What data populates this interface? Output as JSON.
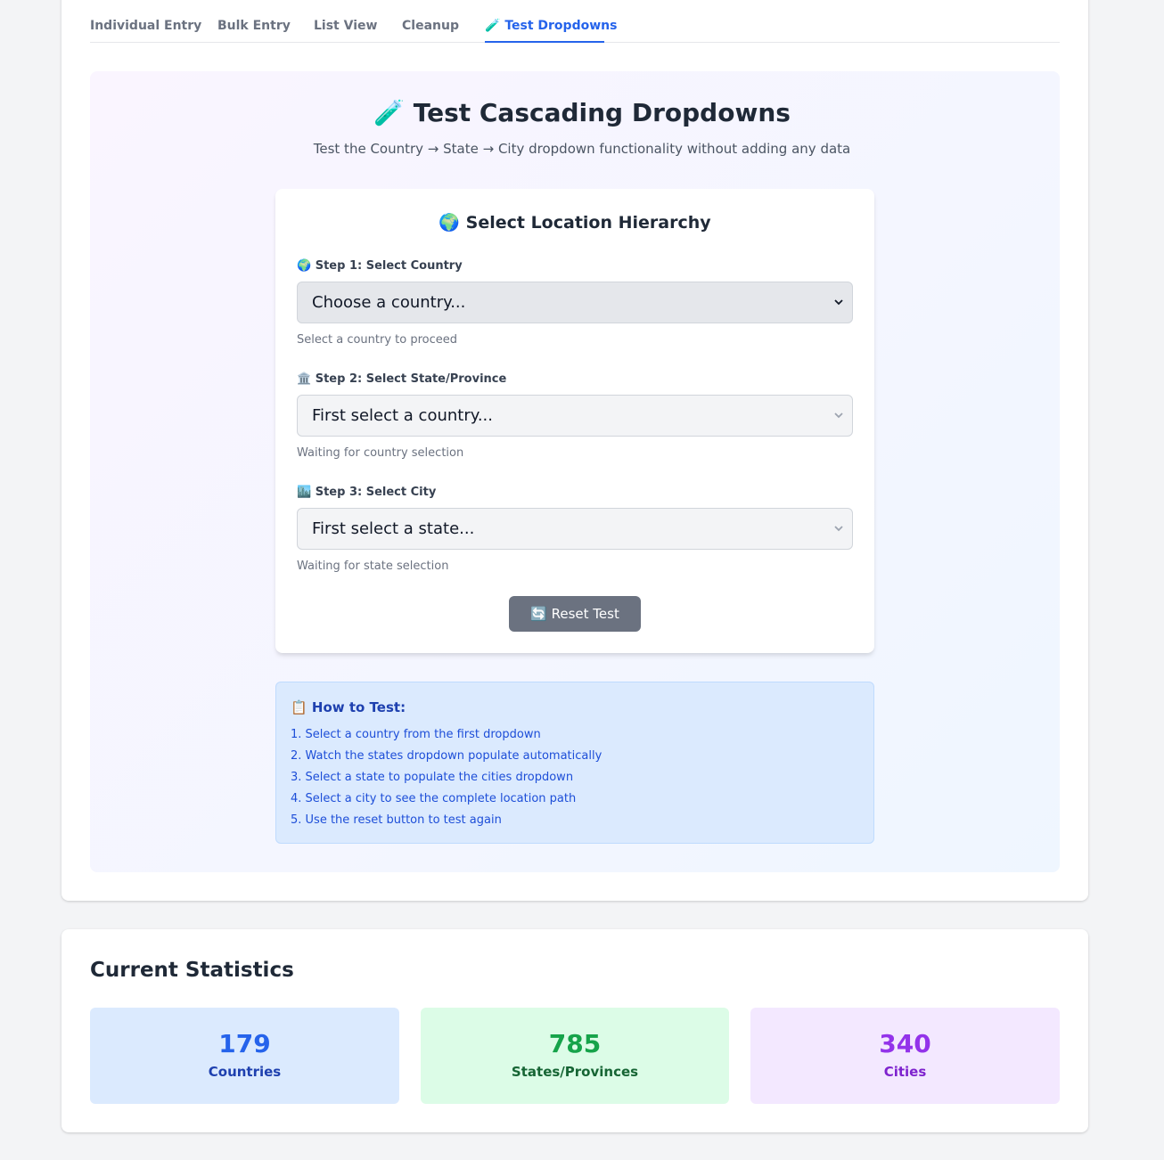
{
  "tabs": [
    {
      "label": "Individual Entry"
    },
    {
      "label": "Bulk Entry"
    },
    {
      "label": "List View"
    },
    {
      "label": "Cleanup"
    },
    {
      "label": "Test Dropdowns",
      "icon": "test-tube-icon",
      "active": true
    }
  ],
  "panel": {
    "title": "Test Cascading Dropdowns",
    "subtitle": "Test the Country → State → City dropdown functionality without adding any data"
  },
  "selector": {
    "title": "Select Location Hierarchy",
    "steps": [
      {
        "label": "Step 1: Select Country",
        "icon": "globe-icon",
        "value": "Choose a country...",
        "helper": "Select a country to proceed"
      },
      {
        "label": "Step 2: Select State/Province",
        "icon": "classical-building-icon",
        "value": "First select a country...",
        "helper": "Waiting for country selection"
      },
      {
        "label": "Step 3: Select City",
        "icon": "cityscape-icon",
        "value": "First select a state...",
        "helper": "Waiting for state selection"
      }
    ],
    "reset_label": "Reset Test"
  },
  "howto": {
    "title": "How to Test:",
    "items": [
      "1. Select a country from the first dropdown",
      "2. Watch the states dropdown populate automatically",
      "3. Select a state to populate the cities dropdown",
      "4. Select a city to see the complete location path",
      "5. Use the reset button to test again"
    ]
  },
  "stats": {
    "title": "Current Statistics",
    "items": [
      {
        "value": "179",
        "label": "Countries",
        "bg": "#dbeafe",
        "color": "#2563eb",
        "label_color": "#1e40af"
      },
      {
        "value": "785",
        "label": "States/Provinces",
        "bg": "#dcfce7",
        "color": "#16a34a",
        "label_color": "#166534"
      },
      {
        "value": "340",
        "label": "Cities",
        "bg": "#f3e8ff",
        "color": "#9333ea",
        "label_color": "#7e22ce"
      }
    ]
  },
  "colors": {
    "accent": "#2563eb",
    "reset_button": "#6b7280"
  }
}
